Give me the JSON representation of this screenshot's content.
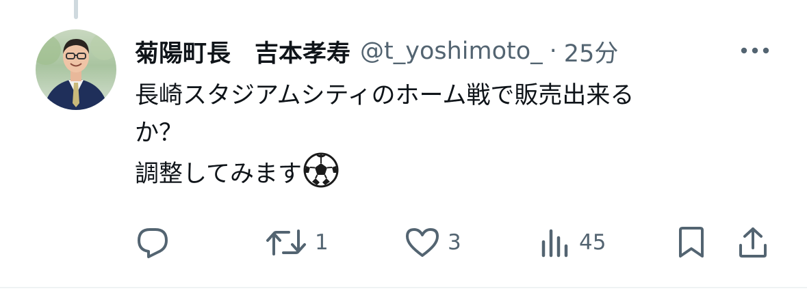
{
  "tweet": {
    "display_name": "菊陽町長　吉本孝寿",
    "handle": "@t_yoshimoto_",
    "separator": "·",
    "time": "25分",
    "text_lines": [
      "長崎スタジアムシティのホーム戦で販売出来る",
      "か？",
      "調整してみます"
    ],
    "emoji": "soccer-ball"
  },
  "actions": {
    "reply": {
      "icon": "reply-icon",
      "count": ""
    },
    "retweet": {
      "icon": "retweet-icon",
      "count": "1"
    },
    "like": {
      "icon": "heart-icon",
      "count": "3"
    },
    "views": {
      "icon": "views-chart-icon",
      "count": "45"
    },
    "bookmark": {
      "icon": "bookmark-icon"
    },
    "share": {
      "icon": "share-icon"
    }
  },
  "colors": {
    "text_primary": "#0f1419",
    "text_secondary": "#536471",
    "thread_line": "#cfd9de",
    "divider": "#eff3f4"
  }
}
